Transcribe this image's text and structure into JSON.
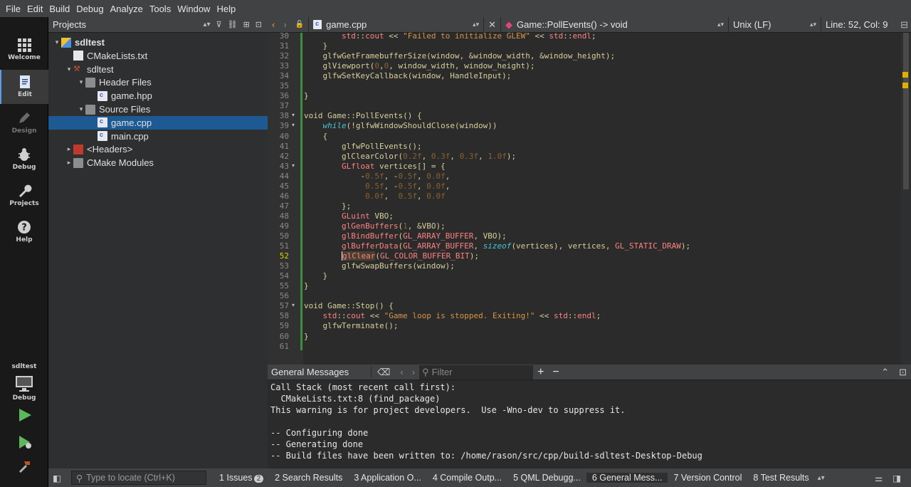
{
  "menu": [
    "File",
    "Edit",
    "Build",
    "Debug",
    "Analyze",
    "Tools",
    "Window",
    "Help"
  ],
  "modes": [
    {
      "label": "Welcome",
      "icon": "grid-icon"
    },
    {
      "label": "Edit",
      "icon": "document-icon"
    },
    {
      "label": "Design",
      "icon": "pencil-icon"
    },
    {
      "label": "Debug",
      "icon": "bug-icon"
    },
    {
      "label": "Projects",
      "icon": "wrench-icon"
    },
    {
      "label": "Help",
      "icon": "help-icon"
    }
  ],
  "kit": {
    "project": "sdltest",
    "config": "Debug"
  },
  "projects": {
    "title": "Projects",
    "tree": [
      {
        "label": "sdltest",
        "depth": 0,
        "arrow": "▾",
        "icon": "project",
        "bold": true
      },
      {
        "label": "CMakeLists.txt",
        "depth": 1,
        "arrow": "",
        "icon": "txt"
      },
      {
        "label": "sdltest",
        "depth": 1,
        "arrow": "▾",
        "icon": "hammer"
      },
      {
        "label": "Header Files",
        "depth": 2,
        "arrow": "▾",
        "icon": "folder"
      },
      {
        "label": "game.hpp",
        "depth": 3,
        "arrow": "",
        "icon": "cpp"
      },
      {
        "label": "Source Files",
        "depth": 2,
        "arrow": "▾",
        "icon": "folder"
      },
      {
        "label": "game.cpp",
        "depth": 3,
        "arrow": "",
        "icon": "cpp",
        "selected": true
      },
      {
        "label": "main.cpp",
        "depth": 3,
        "arrow": "",
        "icon": "cpp"
      },
      {
        "label": "<Headers>",
        "depth": 1,
        "arrow": "▸",
        "icon": "red"
      },
      {
        "label": "CMake Modules",
        "depth": 1,
        "arrow": "▸",
        "icon": "folder"
      }
    ]
  },
  "editor": {
    "file": "game.cpp",
    "symbol": "Game::PollEvents() -> void",
    "line_ending": "Unix (LF)",
    "position": "Line: 52, Col: 9",
    "first_line": 30,
    "current_line": 52,
    "fold_lines": [
      38,
      39,
      43,
      57
    ],
    "lines": [
      "        std::cout << \"Failed to initialize GLEW\" << std::endl;",
      "    }",
      "    glfwGetFramebufferSize(window, &window_width, &window_height);",
      "    glViewport(0,0, window_width, window_height);",
      "    glfwSetKeyCallback(window, HandleInput);",
      "",
      "}",
      "",
      "void Game::PollEvents() {",
      "    while(!glfwWindowShouldClose(window))",
      "    {",
      "        glfwPollEvents();",
      "        glClearColor(0.2f, 0.3f, 0.3f, 1.0f);",
      "        GLfloat vertices[] = {",
      "            -0.5f, -0.5f, 0.0f,",
      "             0.5f, -0.5f, 0.0f,",
      "             0.0f,  0.5f, 0.0f",
      "        };",
      "        GLuint VBO;",
      "        glGenBuffers(1, &VBO);",
      "        glBindBuffer(GL_ARRAY_BUFFER, VBO);",
      "        glBufferData(GL_ARRAY_BUFFER, sizeof(vertices), vertices, GL_STATIC_DRAW);",
      "        glClear(GL_COLOR_BUFFER_BIT);",
      "        glfwSwapBuffers(window);",
      "    }",
      "}",
      "",
      "void Game::Stop() {",
      "    std::cout << \"Game loop is stopped. Exiting!\" << std::endl;",
      "    glfwTerminate();",
      "}",
      ""
    ]
  },
  "output": {
    "title": "General Messages",
    "filter_placeholder": "Filter",
    "lines": [
      "Call Stack (most recent call first):",
      "  CMakeLists.txt:8 (find_package)",
      "This warning is for project developers.  Use -Wno-dev to suppress it.",
      "",
      "-- Configuring done",
      "-- Generating done",
      "-- Build files have been written to: /home/rason/src/cpp/build-sdltest-Desktop-Debug"
    ]
  },
  "statusbar": {
    "locate_placeholder": "Type to locate (Ctrl+K)",
    "tabs": [
      {
        "label": "1  Issues",
        "badge": "2"
      },
      {
        "label": "2  Search Results"
      },
      {
        "label": "3  Application O..."
      },
      {
        "label": "4  Compile Outp..."
      },
      {
        "label": "5  QML Debugg..."
      },
      {
        "label": "6  General Mess...",
        "active": true
      },
      {
        "label": "7  Version Control"
      },
      {
        "label": "8  Test Results"
      }
    ]
  },
  "colors": {
    "accent": "#1d5a93",
    "changebar": "#3a8f3a",
    "marker": "#e0b000"
  }
}
